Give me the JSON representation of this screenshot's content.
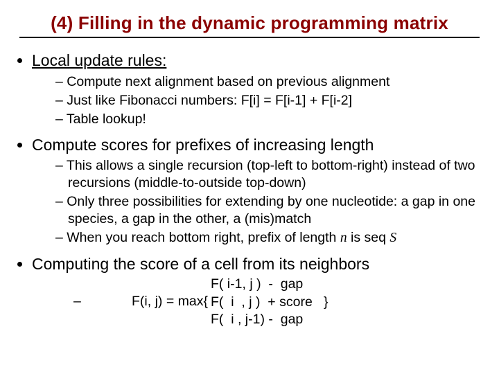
{
  "title": "(4) Filling in the dynamic programming matrix",
  "bullets": {
    "b1": {
      "label": "Local update rules:",
      "subs": [
        "Compute next alignment based on previous alignment",
        "Just like Fibonacci numbers:  F[i] = F[i-1] + F[i-2]",
        "Table lookup!"
      ]
    },
    "b2": {
      "label": "Compute scores for prefixes of increasing length",
      "subs": [
        "This allows a single recursion (top-left to bottom-right) instead of two recursions (middle-to-outside top-down)",
        "Only three possibilities for extending by one nucleotide: a gap in one species, a gap in the other, a (mis)match"
      ],
      "sub3_pre": "When you reach bottom right, prefix of length ",
      "sub3_n": "n",
      "sub3_mid": " is seq ",
      "sub3_S": "S"
    },
    "b3": {
      "label": "Computing the score of a cell from its neighbors",
      "formula": {
        "dash": "–",
        "lhs": "F(i, j) = max{",
        "line1": "F( i-1, j )  -  gap",
        "line2": "F(  i  , j )  + score   }",
        "line3": "F(  i , j-1) -  gap"
      }
    }
  }
}
